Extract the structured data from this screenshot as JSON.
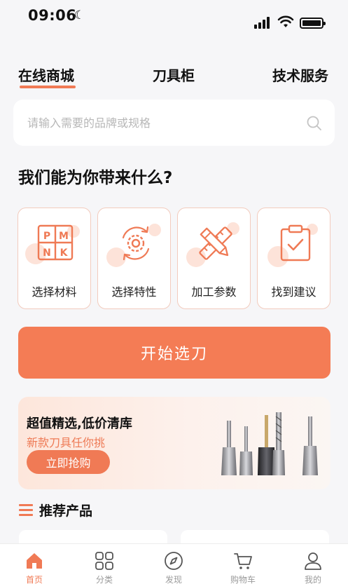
{
  "status_bar": {
    "time": "09:06"
  },
  "top_tabs": [
    {
      "label": "在线商城",
      "active": true
    },
    {
      "label": "刀具柜",
      "active": false
    },
    {
      "label": "技术服务",
      "active": false
    }
  ],
  "search": {
    "placeholder": "请输入需要的品牌或规格",
    "icon": "search-icon"
  },
  "section_question": "我们能为你带来什么?",
  "features": [
    {
      "label": "选择材料",
      "icon": "material-grid-icon",
      "icon_letters": [
        "P",
        "M",
        "N",
        "K"
      ]
    },
    {
      "label": "选择特性",
      "icon": "gear-cycle-icon"
    },
    {
      "label": "加工参数",
      "icon": "ruler-pencil-icon"
    },
    {
      "label": "找到建议",
      "icon": "clipboard-check-icon"
    }
  ],
  "start_button": "开始选刀",
  "banner": {
    "title": "超值精选,低价清库",
    "subtitle": "新款刀具任你挑",
    "button": "立即抢购"
  },
  "recommended_title": "推荐产品",
  "bottom_nav": [
    {
      "label": "首页",
      "icon": "home-icon",
      "active": true
    },
    {
      "label": "分类",
      "icon": "category-grid-icon",
      "active": false
    },
    {
      "label": "发现",
      "icon": "compass-icon",
      "active": false
    },
    {
      "label": "购物车",
      "icon": "cart-icon",
      "active": false
    },
    {
      "label": "我的",
      "icon": "profile-icon",
      "active": false
    }
  ],
  "colors": {
    "accent": "#f47c55",
    "accent_light": "#fde3d9",
    "background": "#f6f6f8"
  }
}
